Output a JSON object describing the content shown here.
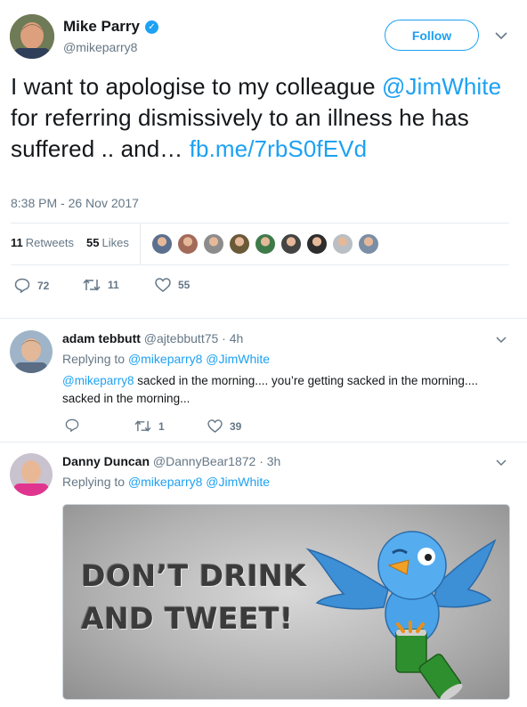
{
  "main_tweet": {
    "display_name": "Mike Parry",
    "handle": "@mikeparry8",
    "follow_label": "Follow",
    "text_segments": [
      {
        "text": "I want to apologise to my colleague ",
        "type": "plain"
      },
      {
        "text": "@JimWhite",
        "type": "link"
      },
      {
        "text": " for referring dismissively to an illness he has suffered .. and… ",
        "type": "plain"
      },
      {
        "text": "fb.me/7rbS0fEVd",
        "type": "link"
      }
    ],
    "timestamp": "8:38 PM - 26 Nov 2017",
    "retweets_count": "11",
    "retweets_label": "Retweets",
    "likes_count": "55",
    "likes_label": "Likes",
    "reply_count": "72",
    "retweet_count": "11",
    "like_count": "55"
  },
  "replies": [
    {
      "display_name": "adam tebbutt",
      "handle": "@ajtebbutt75",
      "time": "· 4h",
      "replying_label": "Replying to",
      "replying_to": [
        "@mikeparry8",
        "@JimWhite"
      ],
      "mention": "@mikeparry8",
      "text": " sacked in the morning.... you’re getting sacked in the morning.... sacked in the morning...",
      "retweet_count": "1",
      "like_count": "39"
    },
    {
      "display_name": "Danny Duncan",
      "handle": "@DannyBear1872",
      "time": "· 3h",
      "replying_label": "Replying to",
      "replying_to": [
        "@mikeparry8",
        "@JimWhite"
      ],
      "media_text_line1": "DON’T DRINK",
      "media_text_line2": "AND TWEET!"
    }
  ],
  "liker_colors": [
    "#5b6f8f",
    "#a36a5a",
    "#8c8c8c",
    "#6b5a3a",
    "#3f7a4a",
    "#444444",
    "#2d2d2d",
    "#b9bfc4",
    "#7a8ea6"
  ],
  "colors": {
    "accent": "#1da1f2",
    "muted": "#657786",
    "border": "#e6ecf0"
  }
}
